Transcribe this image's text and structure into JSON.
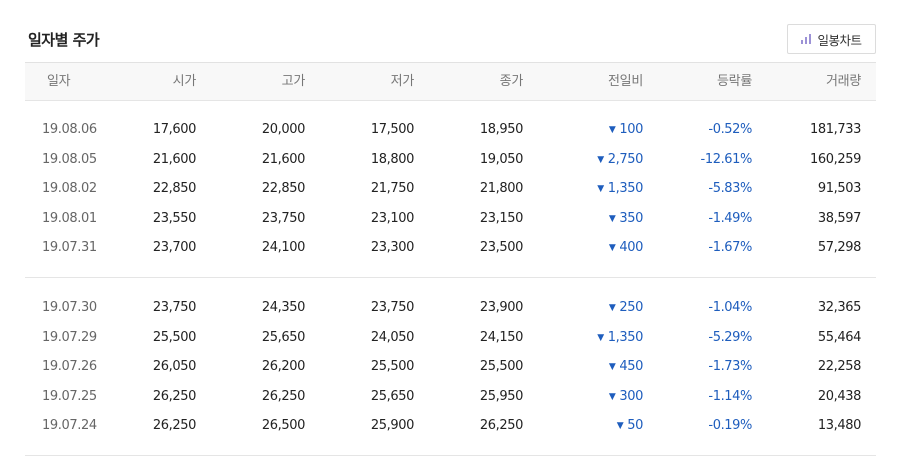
{
  "title": "일자별 주가",
  "chart_button": {
    "label": "일봉차트",
    "icon": "bar-chart-icon"
  },
  "colors": {
    "down": "#1e5dbd",
    "icon": "#9c92d6"
  },
  "headers": [
    "일자",
    "시가",
    "고가",
    "저가",
    "종가",
    "전일비",
    "등락률",
    "거래량"
  ],
  "groups": [
    [
      {
        "date": "19.08.06",
        "open": "17,600",
        "high": "20,000",
        "low": "17,500",
        "close": "18,950",
        "arrow": "▼",
        "change": "100",
        "rate": "-0.52%",
        "volume": "181,733"
      },
      {
        "date": "19.08.05",
        "open": "21,600",
        "high": "21,600",
        "low": "18,800",
        "close": "19,050",
        "arrow": "▼",
        "change": "2,750",
        "rate": "-12.61%",
        "volume": "160,259"
      },
      {
        "date": "19.08.02",
        "open": "22,850",
        "high": "22,850",
        "low": "21,750",
        "close": "21,800",
        "arrow": "▼",
        "change": "1,350",
        "rate": "-5.83%",
        "volume": "91,503"
      },
      {
        "date": "19.08.01",
        "open": "23,550",
        "high": "23,750",
        "low": "23,100",
        "close": "23,150",
        "arrow": "▼",
        "change": "350",
        "rate": "-1.49%",
        "volume": "38,597"
      },
      {
        "date": "19.07.31",
        "open": "23,700",
        "high": "24,100",
        "low": "23,300",
        "close": "23,500",
        "arrow": "▼",
        "change": "400",
        "rate": "-1.67%",
        "volume": "57,298"
      }
    ],
    [
      {
        "date": "19.07.30",
        "open": "23,750",
        "high": "24,350",
        "low": "23,750",
        "close": "23,900",
        "arrow": "▼",
        "change": "250",
        "rate": "-1.04%",
        "volume": "32,365"
      },
      {
        "date": "19.07.29",
        "open": "25,500",
        "high": "25,650",
        "low": "24,050",
        "close": "24,150",
        "arrow": "▼",
        "change": "1,350",
        "rate": "-5.29%",
        "volume": "55,464"
      },
      {
        "date": "19.07.26",
        "open": "26,050",
        "high": "26,200",
        "low": "25,500",
        "close": "25,500",
        "arrow": "▼",
        "change": "450",
        "rate": "-1.73%",
        "volume": "22,258"
      },
      {
        "date": "19.07.25",
        "open": "26,250",
        "high": "26,250",
        "low": "25,650",
        "close": "25,950",
        "arrow": "▼",
        "change": "300",
        "rate": "-1.14%",
        "volume": "20,438"
      },
      {
        "date": "19.07.24",
        "open": "26,250",
        "high": "26,500",
        "low": "25,900",
        "close": "26,250",
        "arrow": "▼",
        "change": "50",
        "rate": "-0.19%",
        "volume": "13,480"
      }
    ]
  ]
}
